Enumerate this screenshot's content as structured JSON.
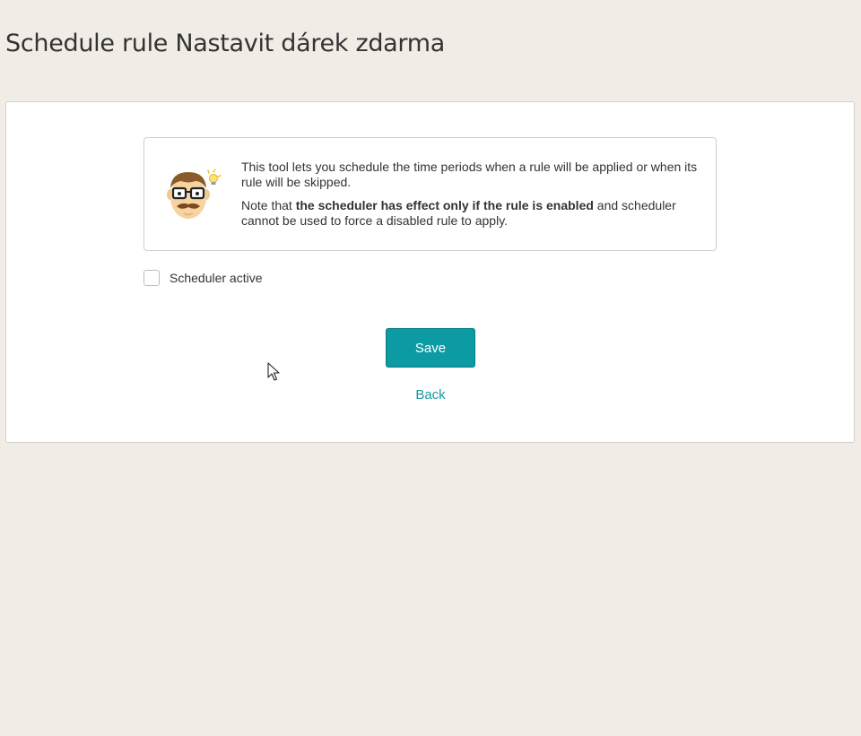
{
  "page": {
    "title": "Schedule rule Nastavit dárek zdarma"
  },
  "info": {
    "mascot_icon": "mustache-man-lightbulb-icon",
    "line1": "This tool lets you schedule the time periods when a rule will be applied or when its rule will be skipped.",
    "note_prefix": "Note that ",
    "note_bold": "the scheduler has effect only if the rule is enabled",
    "note_suffix": " and scheduler cannot be used to force a disabled rule to apply."
  },
  "form": {
    "scheduler_active_label": "Scheduler active",
    "scheduler_active_checked": false
  },
  "actions": {
    "save_label": "Save",
    "back_label": "Back"
  },
  "colors": {
    "background": "#f1ece6",
    "accent": "#0c9aa3",
    "link": "#1a9aa4"
  }
}
